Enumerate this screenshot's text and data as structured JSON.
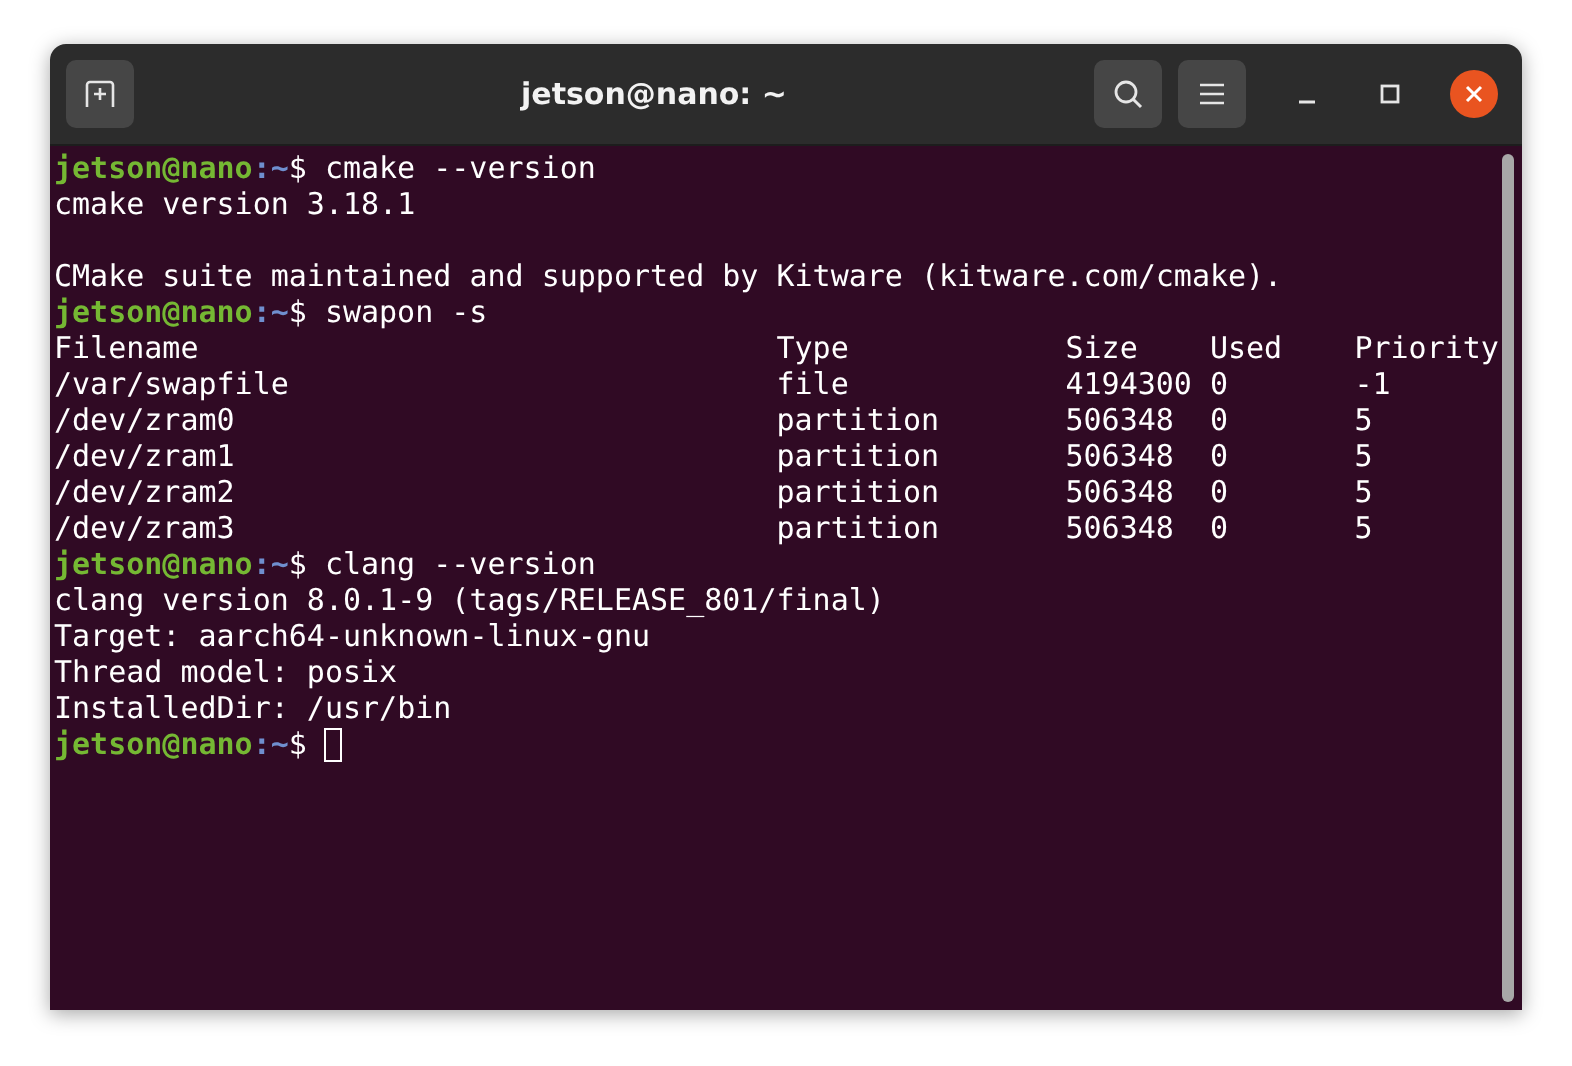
{
  "window": {
    "title": "jetson@nano: ~"
  },
  "terminal": {
    "lines": [
      {
        "kind": "prompt",
        "user": "jetson@nano",
        "path": ":~",
        "symbol": "$",
        "command": "cmake --version"
      },
      {
        "kind": "output",
        "text": "cmake version 3.18.1"
      },
      {
        "kind": "blank"
      },
      {
        "kind": "output",
        "text": "CMake suite maintained and supported by Kitware (kitware.com/cmake)."
      },
      {
        "kind": "prompt",
        "user": "jetson@nano",
        "path": ":~",
        "symbol": "$",
        "command": "swapon -s"
      },
      {
        "kind": "output",
        "text": "Filename                                Type            Size    Used    Priority"
      },
      {
        "kind": "output",
        "text": "/var/swapfile                           file            4194300 0       -1"
      },
      {
        "kind": "output",
        "text": "/dev/zram0                              partition       506348  0       5"
      },
      {
        "kind": "output",
        "text": "/dev/zram1                              partition       506348  0       5"
      },
      {
        "kind": "output",
        "text": "/dev/zram2                              partition       506348  0       5"
      },
      {
        "kind": "output",
        "text": "/dev/zram3                              partition       506348  0       5"
      },
      {
        "kind": "prompt",
        "user": "jetson@nano",
        "path": ":~",
        "symbol": "$",
        "command": "clang --version"
      },
      {
        "kind": "output",
        "text": "clang version 8.0.1-9 (tags/RELEASE_801/final)"
      },
      {
        "kind": "output",
        "text": "Target: aarch64-unknown-linux-gnu"
      },
      {
        "kind": "output",
        "text": "Thread model: posix"
      },
      {
        "kind": "output",
        "text": "InstalledDir: /usr/bin"
      },
      {
        "kind": "prompt",
        "user": "jetson@nano",
        "path": ":~",
        "symbol": "$",
        "cursor": true
      }
    ]
  }
}
